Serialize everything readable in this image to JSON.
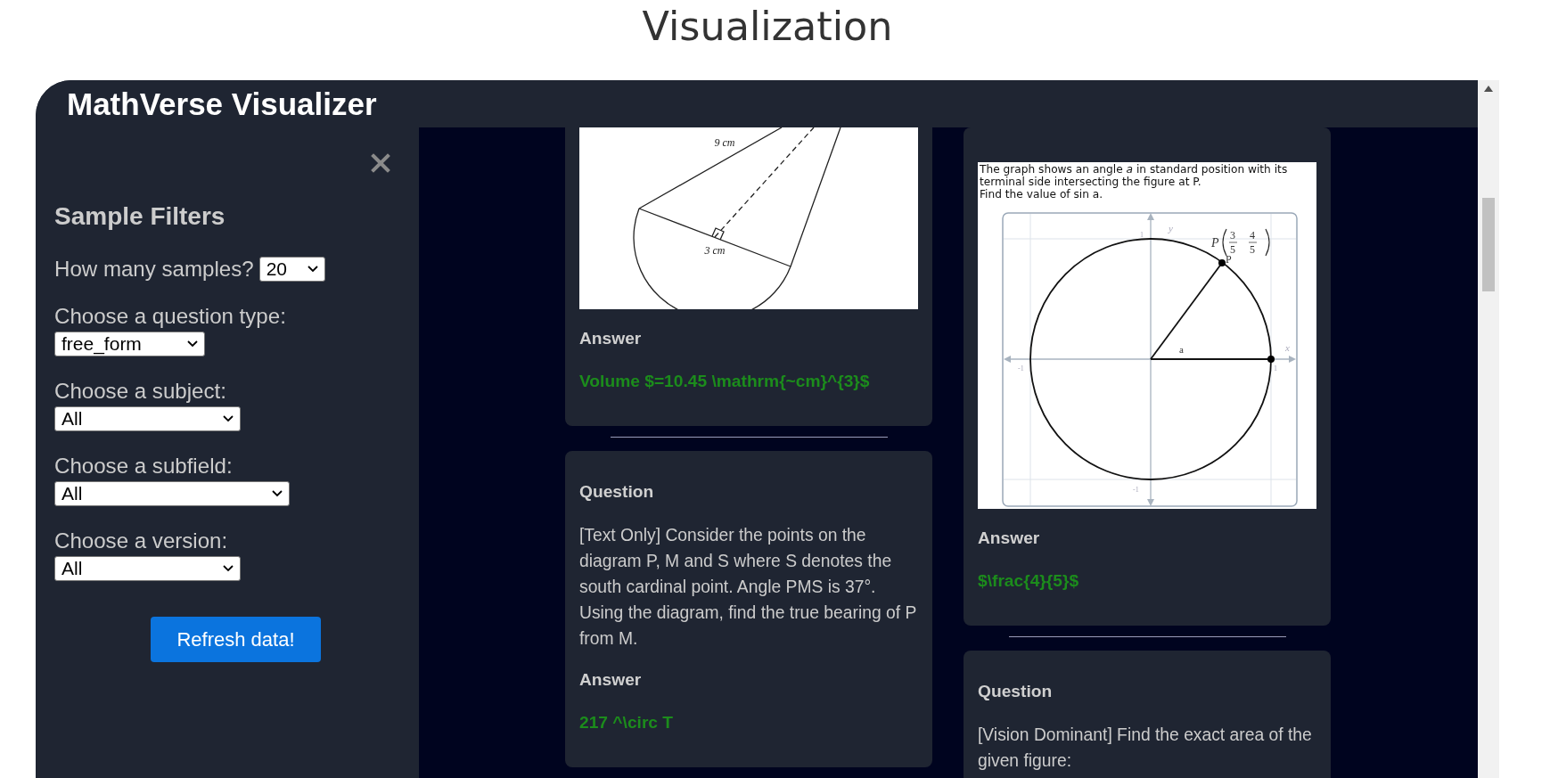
{
  "page_title": "Visualization",
  "app": {
    "title": "MathVerse Visualizer"
  },
  "sidebar": {
    "heading": "Sample Filters",
    "filters": [
      {
        "kind": "inline",
        "label": "How many samples?",
        "value": "20"
      },
      {
        "kind": "stacked",
        "label": "Choose a question type:",
        "value": "free_form"
      },
      {
        "kind": "stacked",
        "label": "Choose a subject:",
        "value": "All"
      },
      {
        "kind": "stacked",
        "label": "Choose a subfield:",
        "value": "All"
      },
      {
        "kind": "stacked",
        "label": "Choose a version:",
        "value": "All"
      }
    ],
    "refresh_button": "Refresh data!"
  },
  "columns": [
    {
      "cards": [
        {
          "figure": {
            "kind": "cone",
            "labels": [
              "9 cm",
              "3 cm"
            ]
          },
          "answer_heading": "Answer",
          "answer": "Volume $=10.45 \\mathrm{~cm}^{3}$"
        },
        {
          "question_heading": "Question",
          "question": "[Text Only] Consider the points on the diagram P, M and S where S denotes the south cardinal point. Angle PMS is 37°. Using the diagram, find the true bearing of P from M.",
          "answer_heading": "Answer",
          "answer": "217 ^\\circ T"
        }
      ]
    },
    {
      "cards": [
        {
          "figure": {
            "kind": "unit_circle",
            "caption": [
              "The graph shows an angle *a* in standard position with its",
              "terminal side intersecting the figure at P.",
              "Find the value of sin a."
            ],
            "axes": [
              "y",
              "x"
            ],
            "ticks": [
              "1",
              "-1",
              "-1",
              "1"
            ],
            "angle": "a",
            "point": "P",
            "coordinate": {
              "name": "P",
              "fractions": [
                {
                  "num": "3",
                  "den": "5"
                },
                {
                  "num": "4",
                  "den": "5"
                }
              ]
            }
          },
          "answer_heading": "Answer",
          "answer": "$\\frac{4}{5}$"
        },
        {
          "question_heading": "Question",
          "question": "[Vision Dominant] Find the exact area of the given figure:"
        }
      ]
    }
  ]
}
